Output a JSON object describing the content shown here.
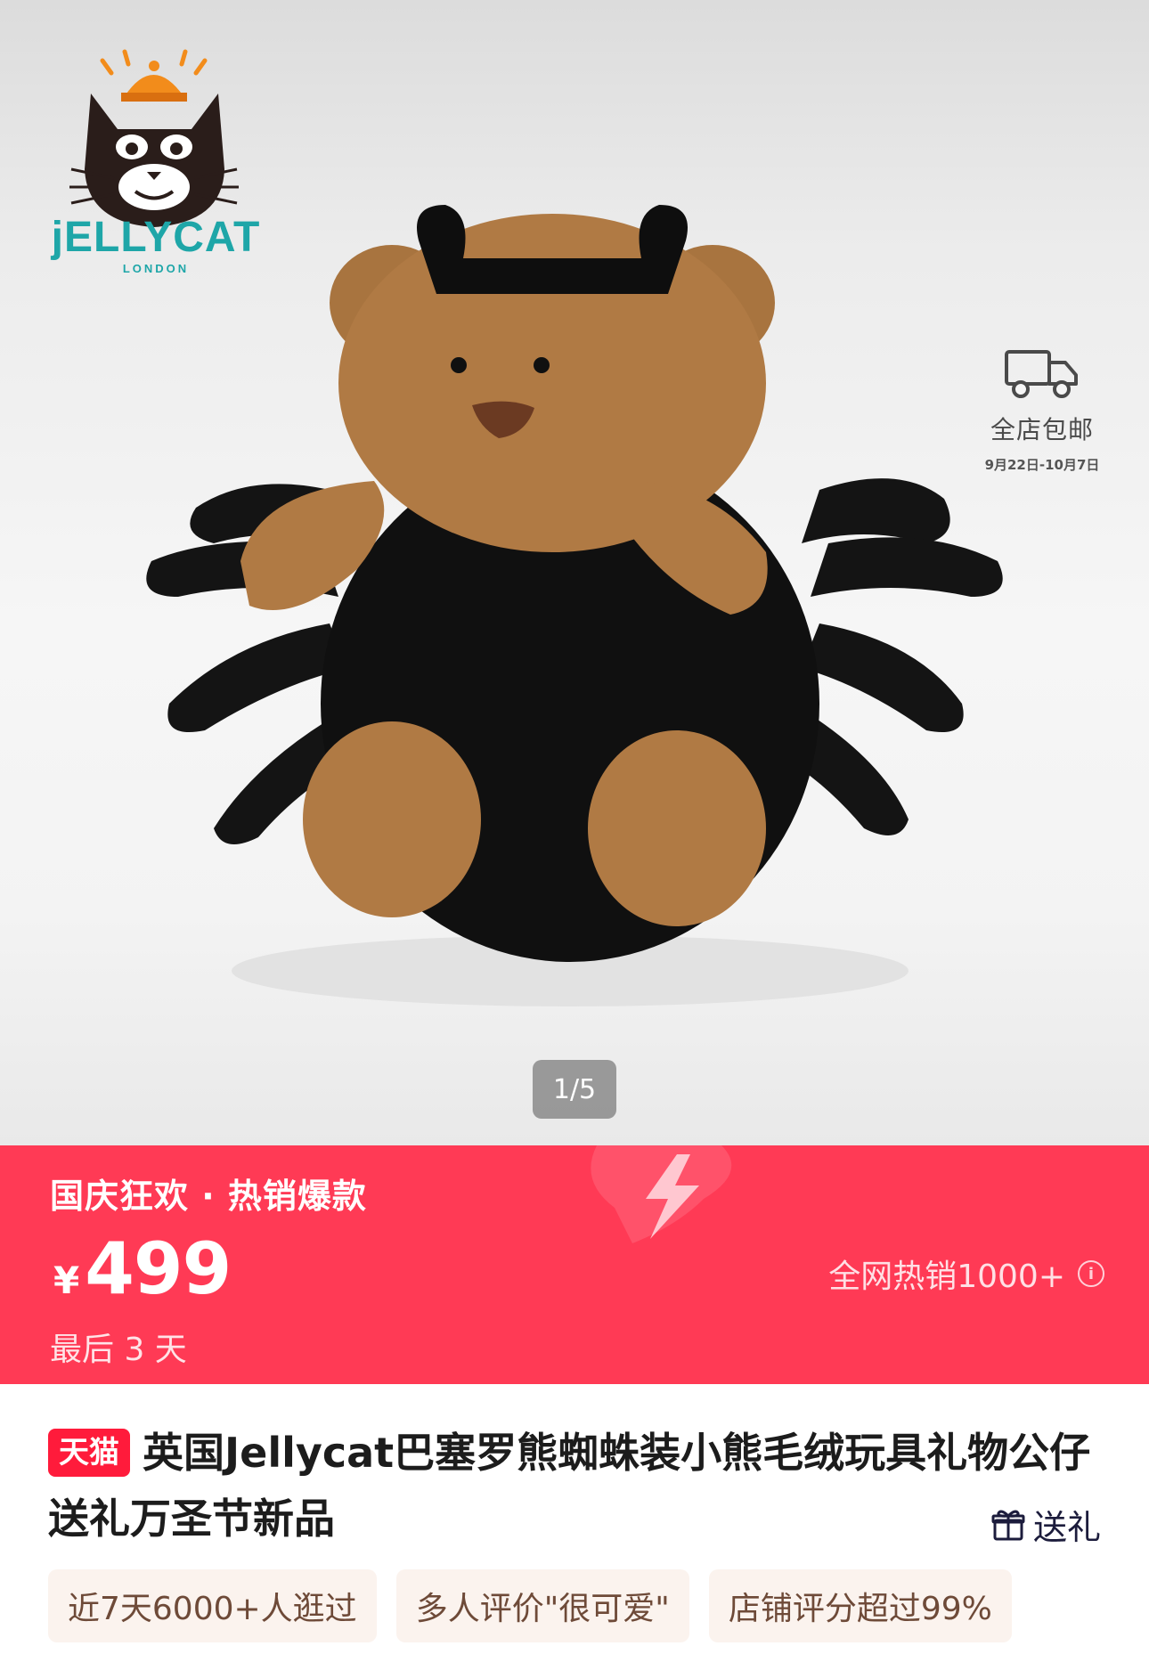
{
  "gallery": {
    "brand_logo": {
      "name": "JELLYCAT",
      "subname": "LONDON",
      "icon": "jellycat-cat-logo"
    },
    "product_image": "bartholomew-bear-spider-costume-plush",
    "shipping": {
      "icon": "truck-icon",
      "title": "全店包邮",
      "dates": "9月22日-10月7日"
    },
    "page_indicator": "1/5"
  },
  "promo": {
    "title": "国庆狂欢 · 热销爆款",
    "currency": "¥",
    "price": "499",
    "sales": "全网热销1000+",
    "info_icon": "info-icon",
    "countdown": "最后 3 天",
    "colors": {
      "banner": "#ff3a55",
      "text": "#ffffff"
    }
  },
  "product": {
    "badge": "天猫",
    "title": "英国Jellycat巴塞罗熊蜘蛛装小熊毛绒玩具礼物公仔送礼万圣节新品",
    "gift_label": "送礼",
    "gift_icon": "gift-icon",
    "tags": [
      "近7天6000+人逛过",
      "多人评价\"很可爱\"",
      "店铺评分超过99%"
    ]
  }
}
